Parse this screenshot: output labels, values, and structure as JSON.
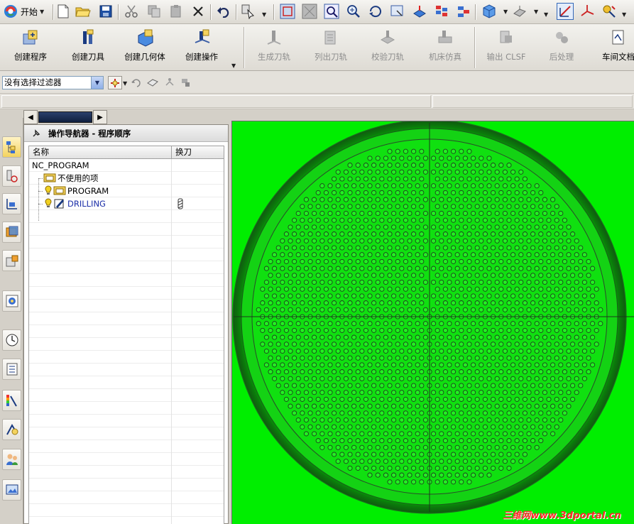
{
  "toolbar_top": {
    "start_label": "开始",
    "icons": [
      "new-file-icon",
      "open-folder-icon",
      "save-icon",
      "cut-icon",
      "copy-icon",
      "paste-icon",
      "delete-icon",
      "undo-icon",
      "select-tool-icon",
      "fit-view-icon",
      "zoom-window-icon",
      "zoom-area-icon",
      "zoom-icon",
      "rotate-icon",
      "pan-icon",
      "tool-path-icon",
      "generate-icon",
      "replay-icon",
      "shaded-cube-icon",
      "render-style-icon",
      "wcs-icon",
      "csys-icon",
      "motion-icon"
    ]
  },
  "toolbar_create": {
    "items": [
      {
        "label": "创建程序",
        "enabled": true
      },
      {
        "label": "创建刀具",
        "enabled": true
      },
      {
        "label": "创建几何体",
        "enabled": true
      },
      {
        "label": "创建操作",
        "enabled": true
      },
      {
        "label": "生成刀轨",
        "enabled": false
      },
      {
        "label": "列出刀轨",
        "enabled": false
      },
      {
        "label": "校验刀轨",
        "enabled": false
      },
      {
        "label": "机床仿真",
        "enabled": false
      },
      {
        "label": "输出 CLSF",
        "enabled": false
      },
      {
        "label": "后处理",
        "enabled": false
      },
      {
        "label": "车间文档",
        "enabled": true
      }
    ]
  },
  "filter": {
    "selected": "没有选择过滤器"
  },
  "navigator": {
    "title": "操作导航器 - 程序顺序",
    "columns": [
      "名称",
      "换刀"
    ],
    "rows": [
      {
        "name": "NC_PROGRAM",
        "level": 0,
        "icon": "",
        "status": "",
        "toolchange": ""
      },
      {
        "name": "不使用的项",
        "level": 1,
        "icon": "program-folder-icon",
        "status": "",
        "toolchange": ""
      },
      {
        "name": "PROGRAM",
        "level": 1,
        "icon": "program-folder-icon",
        "status": "warning",
        "toolchange": ""
      },
      {
        "name": "DRILLING",
        "level": 1,
        "icon": "drilling-operation-icon",
        "status": "warning",
        "toolchange": "tool-change-icon"
      }
    ]
  },
  "resource_bar": {
    "icons": [
      "operation-navigator-icon",
      "machine-tool-navigator-icon",
      "geometry-navigator-icon",
      "method-navigator-icon",
      "part-navigator-icon",
      "web-browser-icon",
      "history-icon",
      "system-materials-icon",
      "color-palette-icon",
      "roles-icon",
      "user-roles-icon",
      "display-settings-icon"
    ]
  },
  "graphics": {
    "background_color": "#00ee00",
    "part": "circular tube sheet with drilled hole pattern"
  },
  "watermark": "三维网www.3dportal.cn"
}
